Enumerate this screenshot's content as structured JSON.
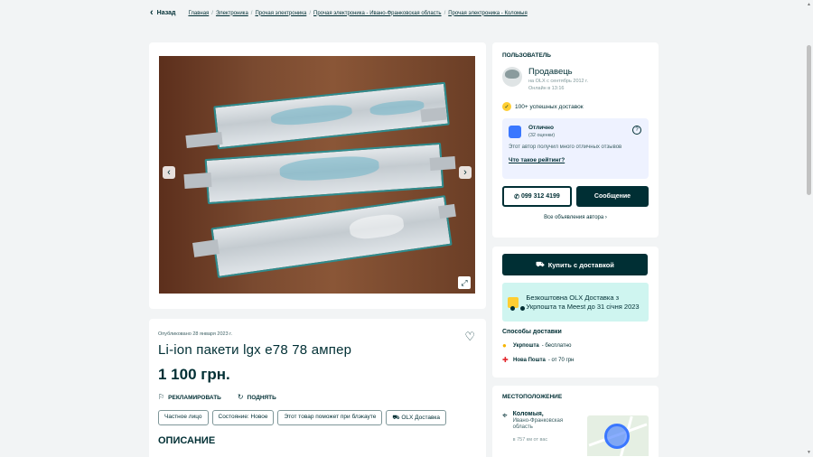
{
  "nav": {
    "back_label": "Назад",
    "breadcrumbs": [
      "Главная",
      "Электроника",
      "Прочая электроника",
      "Прочая электроника - Ивано-Франковская область",
      "Прочая электроника - Коломыя"
    ]
  },
  "gallery": {
    "slide_count": 6,
    "active_slide": 1
  },
  "listing": {
    "published": "Опубликовано 28 января 2023 г.",
    "title": "Li-ion пакети lgx e78 78 ампер",
    "price": "1 100 грн.",
    "advertise_label": "РЕКЛАМИРОВАТЬ",
    "raise_label": "ПОДНЯТЬ",
    "tags": [
      "Частное лицо",
      "Состояние: Новое",
      "Этот товар поможет при блэкауте",
      "OLX Доставка"
    ],
    "description_heading": "ОПИСАНИЕ"
  },
  "user": {
    "section_label": "ПОЛЬЗОВАТЕЛЬ",
    "name": "Продавець",
    "since": "на OLX с сентябрь 2012 г.",
    "online": "Онлайн в 13:16",
    "deliveries": "100+ успешных доставок",
    "rating_title": "Отлично",
    "rating_count": "(32 оценки)",
    "rating_desc": "Этот автор получил много отличных отзывов",
    "rating_link": "Что такое рейтинг?",
    "phone": "099 312 4199",
    "message_label": "Сообщение",
    "all_ads": "Все объявления автора"
  },
  "buy": {
    "button_label": "Купить с доставкой",
    "promo_text": "Безкоштовна OLX Доставка з Укрпошта та Meest до 31 січня 2023",
    "shipping_heading": "Способы доставки",
    "methods": [
      {
        "name": "Укрпошта",
        "detail": "- бесплатно"
      },
      {
        "name": "Нова Пошта",
        "detail": "- от 70 грн"
      }
    ]
  },
  "location": {
    "section_label": "МЕСТОПОЛОЖЕНИЕ",
    "city": "Коломыя,",
    "region": "Ивано-Франковская область",
    "distance": "в 757 км от вас"
  },
  "colors": {
    "primary": "#002f34",
    "accent_blue": "#3a77ff",
    "promo_bg": "#cff5f0",
    "rating_bg": "#eef2ff"
  }
}
